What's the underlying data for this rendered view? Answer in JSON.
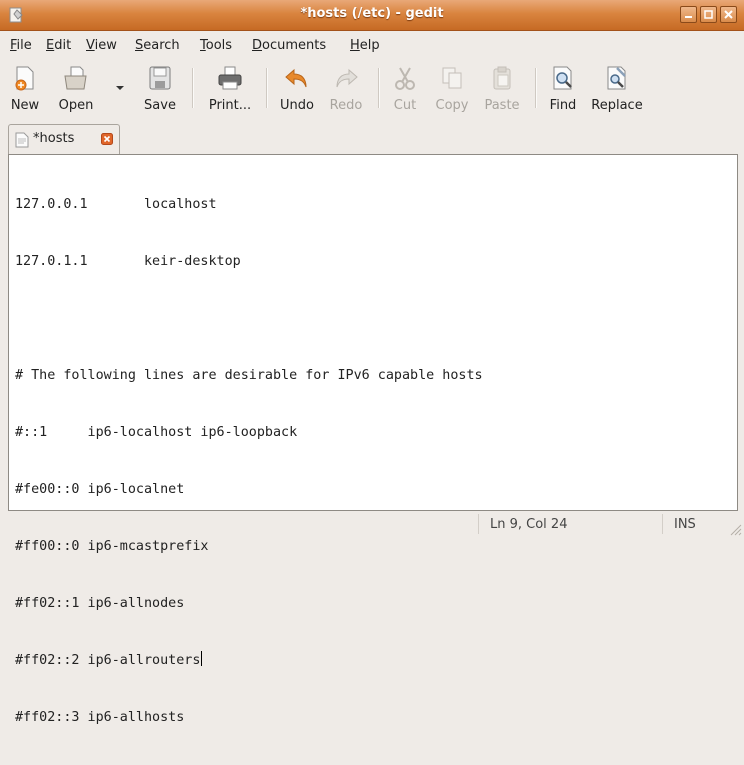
{
  "window": {
    "title": "*hosts (/etc) - gedit"
  },
  "menubar": [
    {
      "label": "File",
      "mnemonic": "F",
      "rest": "ile"
    },
    {
      "label": "Edit",
      "mnemonic": "E",
      "rest": "dit"
    },
    {
      "label": "View",
      "mnemonic": "V",
      "rest": "iew"
    },
    {
      "label": "Search",
      "mnemonic": "S",
      "rest": "earch"
    },
    {
      "label": "Tools",
      "mnemonic": "T",
      "rest": "ools"
    },
    {
      "label": "Documents",
      "mnemonic": "D",
      "rest": "ocuments"
    },
    {
      "label": "Help",
      "mnemonic": "H",
      "rest": "elp"
    }
  ],
  "toolbar": {
    "new": "New",
    "open": "Open",
    "save": "Save",
    "print": "Print...",
    "undo": "Undo",
    "redo": "Redo",
    "cut": "Cut",
    "copy": "Copy",
    "paste": "Paste",
    "find": "Find",
    "replace": "Replace"
  },
  "tab": {
    "label": "*hosts"
  },
  "editor": {
    "lines": [
      "127.0.0.1       localhost",
      "127.0.1.1       keir-desktop",
      "",
      "# The following lines are desirable for IPv6 capable hosts",
      "#::1     ip6-localhost ip6-loopback",
      "#fe00::0 ip6-localnet",
      "#ff00::0 ip6-mcastprefix",
      "#ff02::1 ip6-allnodes",
      "#ff02::2 ip6-allrouters",
      "#ff02::3 ip6-allhosts"
    ],
    "cursor_line": 9
  },
  "statusbar": {
    "position": "Ln 9, Col 24",
    "mode": "INS"
  },
  "colors": {
    "titlebar": "#d9843f",
    "accent_undo": "#e8892b",
    "close_tab": "#e0662a"
  },
  "icons": [
    "gedit-app-icon",
    "minimize-icon",
    "maximize-icon",
    "close-icon",
    "new-document-icon",
    "open-folder-icon",
    "save-disk-icon",
    "printer-icon",
    "undo-arrow-icon",
    "redo-arrow-icon",
    "scissors-icon",
    "copy-icon",
    "paste-clipboard-icon",
    "find-magnifier-icon",
    "replace-icon",
    "text-document-icon",
    "tab-close-icon",
    "resize-grip-icon"
  ]
}
